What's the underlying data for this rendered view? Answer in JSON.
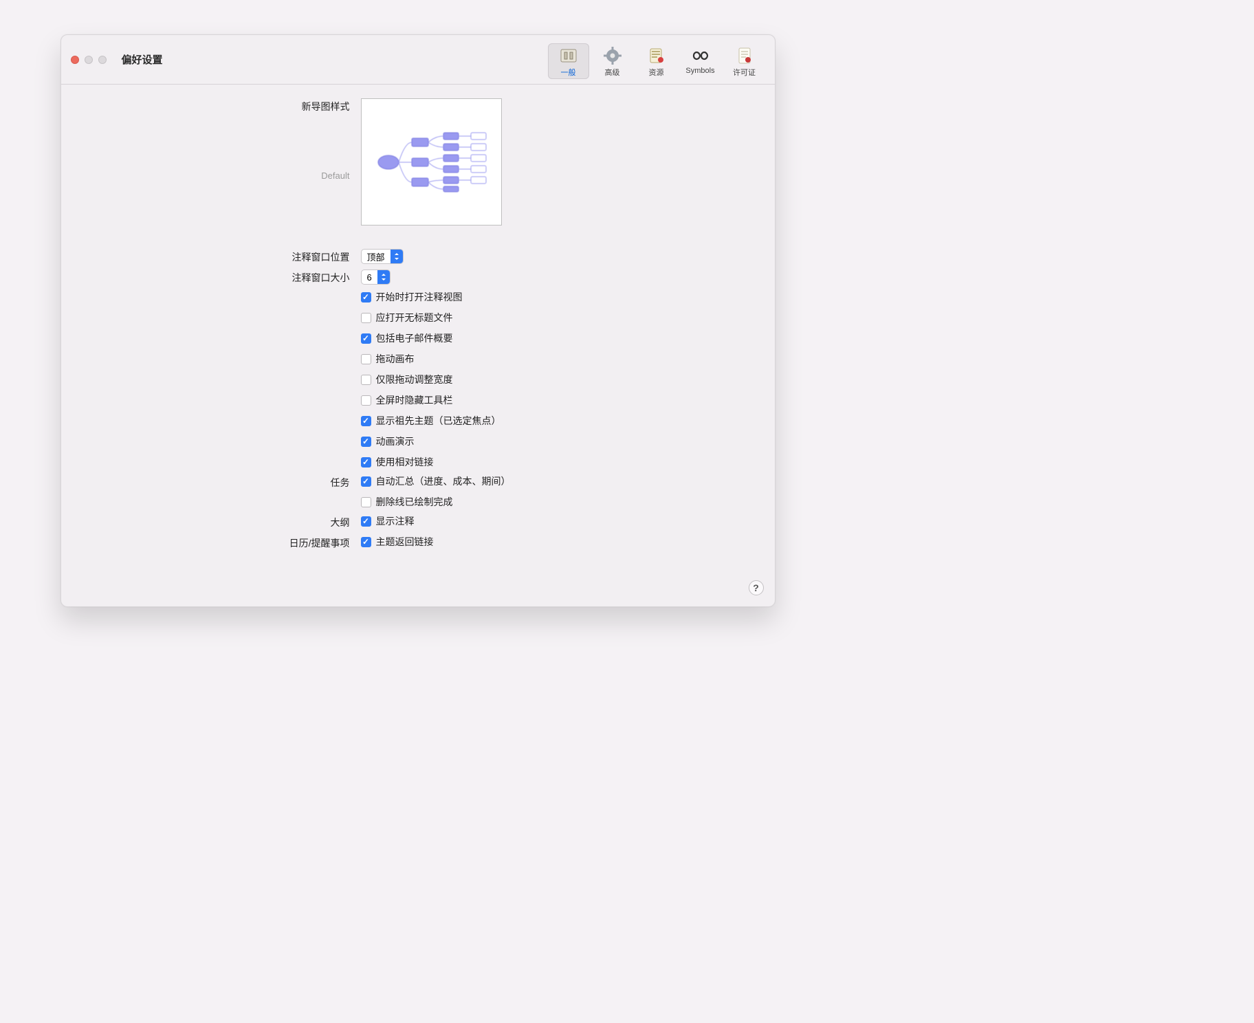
{
  "window": {
    "title": "偏好设置"
  },
  "toolbar": {
    "general": "一般",
    "advanced": "高级",
    "resources": "资源",
    "symbols": "Symbols",
    "license": "许可证"
  },
  "labels": {
    "new_map_style": "新导图样式",
    "default": "Default",
    "notes_pos": "注释窗口位置",
    "notes_size": "注释窗口大小",
    "tasks": "任务",
    "outline": "大纲",
    "calendar": "日历/提醒事项"
  },
  "selects": {
    "notes_pos_value": "顶部",
    "notes_size_value": "6"
  },
  "checks": {
    "open_notes_on_start": {
      "label": "开始时打开注释视图",
      "checked": true
    },
    "open_untitled": {
      "label": "应打开无标题文件",
      "checked": false
    },
    "include_email": {
      "label": "包括电子邮件概要",
      "checked": true
    },
    "drag_canvas": {
      "label": "拖动画布",
      "checked": false
    },
    "drag_width_only": {
      "label": "仅限拖动调整宽度",
      "checked": false
    },
    "hide_toolbar_fullscreen": {
      "label": "全屏时隐藏工具栏",
      "checked": false
    },
    "show_ancestor": {
      "label": "显示祖先主题（已选定焦点）",
      "checked": true
    },
    "animate": {
      "label": "动画演示",
      "checked": true
    },
    "relative_links": {
      "label": "使用相对链接",
      "checked": true
    },
    "auto_rollup": {
      "label": "自动汇总（进度、成本、期间）",
      "checked": true
    },
    "strike_done": {
      "label": "删除线已绘制完成",
      "checked": false
    },
    "show_notes_outline": {
      "label": "显示注释",
      "checked": true
    },
    "topic_backlink": {
      "label": "主题返回链接",
      "checked": true
    }
  },
  "help": "?"
}
